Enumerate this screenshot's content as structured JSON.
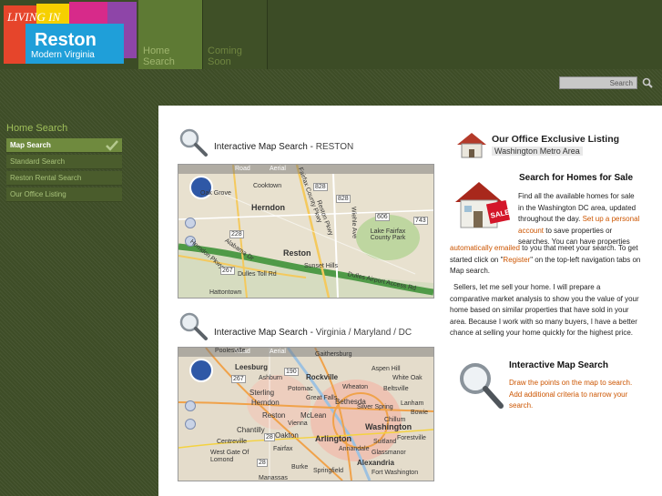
{
  "brand": {
    "line1": "LIVING IN",
    "line2": "Reston",
    "line3": "Modern Virginia"
  },
  "nav": {
    "items": [
      {
        "line1": "Home",
        "line2": "Search"
      },
      {
        "line1": "Coming",
        "line2": "Soon"
      }
    ]
  },
  "search": {
    "placeholder": "Search"
  },
  "sidebar": {
    "title": "Home Search",
    "items": [
      {
        "label": "Map Search",
        "active": true
      },
      {
        "label": "Standard Search"
      },
      {
        "label": "Reston Rental Search"
      },
      {
        "label": "Our Office Listing"
      }
    ]
  },
  "map1": {
    "heading": "Interactive Map Search - ",
    "sub": "RESTON",
    "road": "Road",
    "aerial": "Aerial",
    "places": [
      "Herndon",
      "Reston",
      "Oak Grove",
      "Cooktown",
      "Sunset Hills",
      "Lake Fairfax County Park",
      "Dulles Toll Rd",
      "Dulles Airport Access Rd",
      "Hattontown",
      "Alabama Dr",
      "Herndon Pkwy",
      "Reston Pkwy",
      "Fairfax County Pkwy",
      "Wiehle Ave"
    ],
    "routes": [
      "228",
      "828",
      "828",
      "606",
      "743",
      "267",
      "267"
    ]
  },
  "map2": {
    "heading": "Interactive Map Search - ",
    "sub": "Virginia / Maryland / DC",
    "road": "Road",
    "aerial": "Aerial",
    "places": [
      "Poolesville",
      "Gaithersburg",
      "Leesburg",
      "Rockville",
      "Aspen Hill",
      "White Oak",
      "Ashburn",
      "Potomac",
      "Wheaton",
      "Beltsville",
      "Sterling",
      "Herndon",
      "Great Falls",
      "Bethesda",
      "Reston",
      "McLean",
      "Washington",
      "Chantilly",
      "Oakton",
      "Fairfax",
      "Arlington",
      "Centreville",
      "Alexandria",
      "Burke",
      "Springfield",
      "Annandale",
      "Glassmanor",
      "Fort Washington",
      "Manassas",
      "West Gate Of Lomond",
      "Vienna",
      "Silver Spring",
      "Bowie",
      "Lanham",
      "Forestville",
      "Suitland",
      "Chillum"
    ],
    "routes": [
      "190",
      "267",
      "28",
      "28"
    ]
  },
  "exclusive": {
    "title": "Our Office Exclusive Listing",
    "subtitle": "Washington Metro Area"
  },
  "sale": {
    "title": "Search for Homes for Sale",
    "p1a": "Find all the available homes for sale in the Washington DC area, updated throughout the day. ",
    "p1link1": "Set up a personal account",
    "p1b": " to save properties or searches. You can have properties ",
    "p1link2": "automatically emailed",
    "p1c": " to you that meet your search. To get started click on \"",
    "p1link3": "Register",
    "p1d": "\" on the top-left navigation tabs on Map search.",
    "p2": "Sellers, let me sell your home. I will prepare a comparative market analysis to show you the value of your home based on similar properties that have sold in your area. Because I work with so many buyers, I have a better chance at selling your home quickly for the highest price."
  },
  "interactive": {
    "title": "Interactive Map Search",
    "text": "Draw the points on the map to search. Add additional criteria to narrow your search."
  }
}
